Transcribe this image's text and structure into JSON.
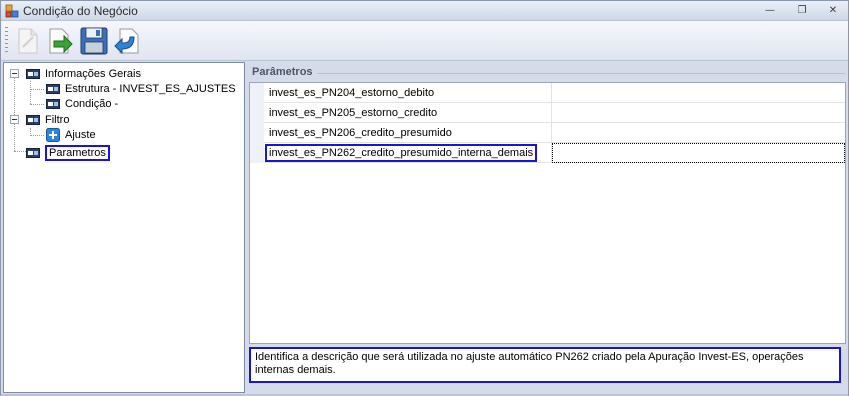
{
  "window": {
    "title": "Condição do Negócio",
    "minimize_glyph": "—",
    "restore_glyph": "❐",
    "close_glyph": "✕"
  },
  "toolbar": {
    "buttons": [
      {
        "icon": "new-document-icon"
      },
      {
        "icon": "open-arrow-icon"
      },
      {
        "icon": "save-disk-icon"
      },
      {
        "icon": "undo-arrow-icon"
      }
    ]
  },
  "tree": {
    "info_gerais": "Informações Gerais",
    "estrutura": "Estrutura - INVEST_ES_AJUSTES",
    "condicao": "Condição -",
    "filtro": "Filtro",
    "ajuste": "Ajuste",
    "parametros": "Parametros"
  },
  "params": {
    "title": "Parâmetros",
    "rows": [
      {
        "name": "invest_es_PN204_estorno_debito",
        "value": ""
      },
      {
        "name": "invest_es_PN205_estorno_credito",
        "value": ""
      },
      {
        "name": "invest_es_PN206_credito_presumido",
        "value": ""
      },
      {
        "name": "invest_es_PN262_credito_presumido_interna_demais",
        "value": ""
      }
    ],
    "description": "Identifica a descrição que será utilizada no ajuste automático PN262 criado pela Apuração Invest-ES, operações internas demais."
  },
  "colors": {
    "selection_outline": "#1a14d6",
    "window_bg": "#d6dbe9"
  }
}
